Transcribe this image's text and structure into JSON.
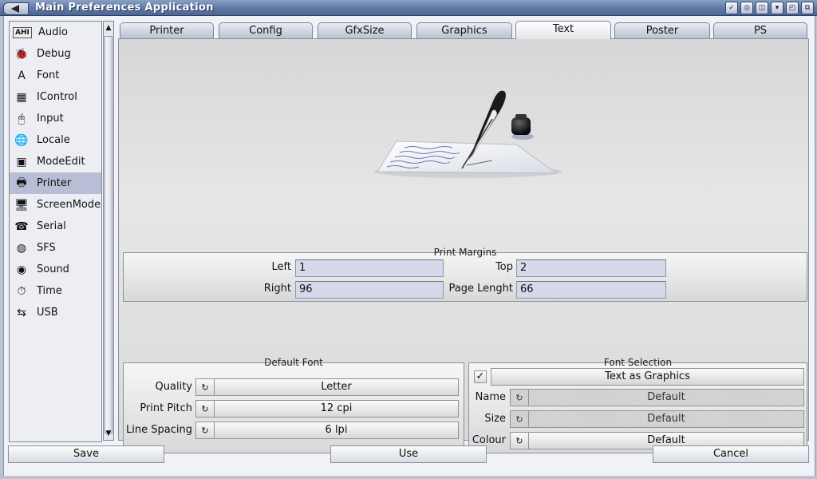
{
  "window": {
    "title": "Main Preferences Application"
  },
  "sidebar": {
    "items": [
      {
        "label": "Audio",
        "icon": "ahi-audio-icon",
        "glyph": "AHI"
      },
      {
        "label": "Debug",
        "icon": "bug-icon",
        "glyph": "🐞"
      },
      {
        "label": "Font",
        "icon": "font-icon",
        "glyph": "A"
      },
      {
        "label": "IControl",
        "icon": "icontrol-icon",
        "glyph": "▦"
      },
      {
        "label": "Input",
        "icon": "mouse-icon",
        "glyph": "🖱"
      },
      {
        "label": "Locale",
        "icon": "globe-icon",
        "glyph": "🌐"
      },
      {
        "label": "ModeEdit",
        "icon": "monitor-icon",
        "glyph": "▣"
      },
      {
        "label": "Printer",
        "icon": "printer-icon",
        "glyph": "🖶",
        "selected": true
      },
      {
        "label": "ScreenMode",
        "icon": "screen-icon",
        "glyph": "🖥"
      },
      {
        "label": "Serial",
        "icon": "phone-icon",
        "glyph": "☎"
      },
      {
        "label": "SFS",
        "icon": "disk-icon",
        "glyph": "◍"
      },
      {
        "label": "Sound",
        "icon": "speaker-icon",
        "glyph": "◉"
      },
      {
        "label": "Time",
        "icon": "clock-icon",
        "glyph": "⏱"
      },
      {
        "label": "USB",
        "icon": "usb-icon",
        "glyph": "⇆"
      }
    ]
  },
  "tabs": [
    {
      "label": "Printer"
    },
    {
      "label": "Config"
    },
    {
      "label": "GfxSize"
    },
    {
      "label": "Graphics"
    },
    {
      "label": "Text",
      "active": true
    },
    {
      "label": "Poster"
    },
    {
      "label": "PS"
    }
  ],
  "print_margins": {
    "title": "Print Margins",
    "left_label": "Left",
    "left_value": "1",
    "top_label": "Top",
    "top_value": "2",
    "right_label": "Right",
    "right_value": "96",
    "page_length_label": "Page Lenght",
    "page_length_value": "66"
  },
  "default_font": {
    "title": "Default Font",
    "quality_label": "Quality",
    "quality_value": "Letter",
    "pitch_label": "Print Pitch",
    "pitch_value": "12 cpi",
    "spacing_label": "Line Spacing",
    "spacing_value": "6 lpi"
  },
  "font_selection": {
    "title": "Font Selection",
    "text_as_graphics": "Text as Graphics",
    "text_as_graphics_checked": true,
    "name_label": "Name",
    "name_value": "Default",
    "size_label": "Size",
    "size_value": "Default",
    "colour_label": "Colour",
    "colour_value": "Default"
  },
  "footer": {
    "save": "Save",
    "use": "Use",
    "cancel": "Cancel"
  }
}
